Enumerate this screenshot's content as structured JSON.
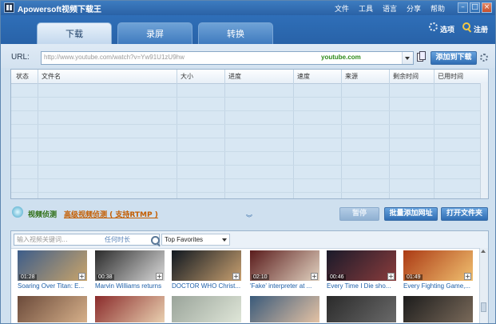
{
  "titlebar": {
    "title": "Apowersoft视频下载王",
    "menu": [
      "文件",
      "工具",
      "语言",
      "分享",
      "帮助"
    ],
    "controls": {
      "minimize": "–",
      "maximize": "□",
      "close": "×"
    }
  },
  "header": {
    "tabs": [
      {
        "label": "下载",
        "active": true
      },
      {
        "label": "录屏",
        "active": false
      },
      {
        "label": "转换",
        "active": false
      }
    ],
    "options_label": "选项",
    "register_label": "注册"
  },
  "url_bar": {
    "label": "URL:",
    "value": "http://www.youtube.com/watch?v=Yw91U1zU9hw",
    "site": "youtube.com",
    "add_button": "添加到下载"
  },
  "table": {
    "columns": [
      "状态",
      "文件名",
      "大小",
      "进度",
      "速度",
      "来源",
      "剩余时间",
      "已用时间"
    ]
  },
  "middle": {
    "video_detect": "视频侦测",
    "advanced_detect": "高级视频侦测 ( 支持RTMP )",
    "expand_glyph": "︾",
    "buttons": {
      "pause": "暂停",
      "batch_add": "批量添加网址",
      "open_folder": "打开文件夹"
    }
  },
  "video_panel": {
    "search_placeholder": "输入视频关键词...",
    "search_time": "任何时长",
    "category": "Top Favorites",
    "add_glyph": "+",
    "videos": [
      {
        "duration": "01:28",
        "title": "Soaring Over Titan: E...",
        "c1": "#3d5d8a",
        "c2": "#c9a46a"
      },
      {
        "duration": "00:38",
        "title": "Marvin Williams returns",
        "c1": "#2b2b2b",
        "c2": "#d9d9d9"
      },
      {
        "duration": "",
        "title": "DOCTOR WHO Christ...",
        "c1": "#101820",
        "c2": "#c8a070"
      },
      {
        "duration": "02:10",
        "title": "'Fake' interpreter at ...",
        "c1": "#5a1c1c",
        "c2": "#e1d2c0"
      },
      {
        "duration": "00:46",
        "title": "Every Time I Die sho...",
        "c1": "#1a1a2a",
        "c2": "#8a3c3c"
      },
      {
        "duration": "01:49",
        "title": "Every Fighting Game,...",
        "c1": "#ab3a14",
        "c2": "#f0c070"
      }
    ],
    "row2": [
      {
        "c1": "#6b4a3a",
        "c2": "#d6b08a"
      },
      {
        "c1": "#8a2b2b",
        "c2": "#e9d0b0"
      },
      {
        "c1": "#9aa49a",
        "c2": "#dfe6d8"
      },
      {
        "c1": "#3a5a7a",
        "c2": "#e4c2a4"
      },
      {
        "c1": "#2a2a2a",
        "c2": "#6a6a6a"
      },
      {
        "c1": "#1c1c1c",
        "c2": "#7a6a5a"
      }
    ]
  }
}
